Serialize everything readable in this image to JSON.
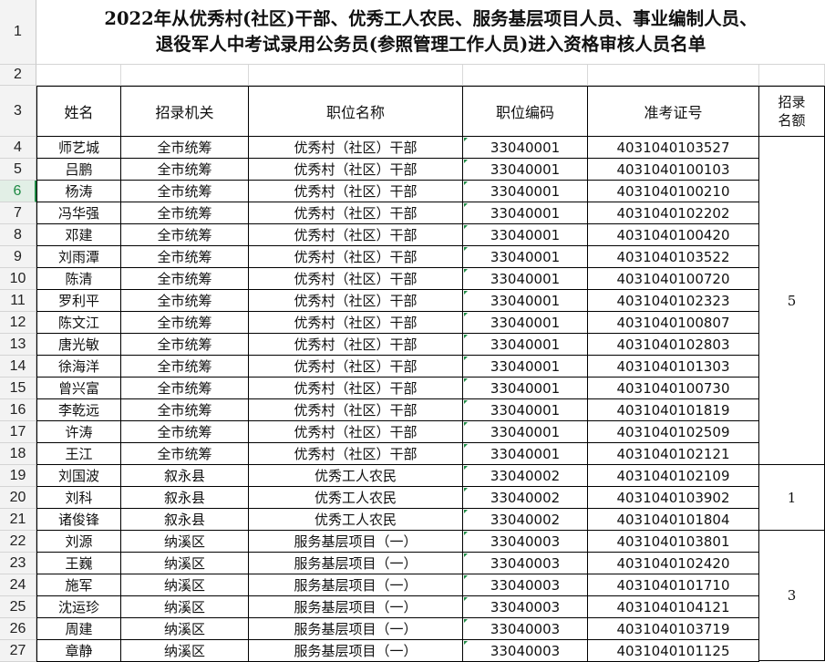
{
  "sheet": {
    "title_lines": [
      "2022年从优秀村(社区)干部、优秀工人农民、服务基层项目人员、事业编制人员、",
      "退役军人中考试录用公务员(参照管理工作人员)进入资格审核人员名单"
    ],
    "active_row": 6,
    "row_numbers": [
      "1",
      "2",
      "3",
      "4",
      "5",
      "6",
      "7",
      "8",
      "9",
      "10",
      "11",
      "12",
      "13",
      "14",
      "15",
      "16",
      "17",
      "18",
      "19",
      "20",
      "21",
      "22",
      "23",
      "24",
      "25",
      "26",
      "27"
    ],
    "headers": {
      "name": "姓名",
      "agency": "招录机关",
      "position": "职位名称",
      "code": "职位编码",
      "ticket": "准考证号",
      "quota": [
        "招录",
        "名额"
      ]
    },
    "rows": [
      {
        "name": "师艺城",
        "agency": "全市统筹",
        "position": "优秀村（社区）干部",
        "code": "33040001",
        "ticket": "4031040103527"
      },
      {
        "name": "吕鹏",
        "agency": "全市统筹",
        "position": "优秀村（社区）干部",
        "code": "33040001",
        "ticket": "4031040100103"
      },
      {
        "name": "杨涛",
        "agency": "全市统筹",
        "position": "优秀村（社区）干部",
        "code": "33040001",
        "ticket": "4031040100210"
      },
      {
        "name": "冯华强",
        "agency": "全市统筹",
        "position": "优秀村（社区）干部",
        "code": "33040001",
        "ticket": "4031040102202"
      },
      {
        "name": "邓建",
        "agency": "全市统筹",
        "position": "优秀村（社区）干部",
        "code": "33040001",
        "ticket": "4031040100420"
      },
      {
        "name": "刘雨潭",
        "agency": "全市统筹",
        "position": "优秀村（社区）干部",
        "code": "33040001",
        "ticket": "4031040103522"
      },
      {
        "name": "陈清",
        "agency": "全市统筹",
        "position": "优秀村（社区）干部",
        "code": "33040001",
        "ticket": "4031040100720"
      },
      {
        "name": "罗利平",
        "agency": "全市统筹",
        "position": "优秀村（社区）干部",
        "code": "33040001",
        "ticket": "4031040102323"
      },
      {
        "name": "陈文江",
        "agency": "全市统筹",
        "position": "优秀村（社区）干部",
        "code": "33040001",
        "ticket": "4031040100807"
      },
      {
        "name": "唐光敏",
        "agency": "全市统筹",
        "position": "优秀村（社区）干部",
        "code": "33040001",
        "ticket": "4031040102803"
      },
      {
        "name": "徐海洋",
        "agency": "全市统筹",
        "position": "优秀村（社区）干部",
        "code": "33040001",
        "ticket": "4031040101303"
      },
      {
        "name": "曾兴富",
        "agency": "全市统筹",
        "position": "优秀村（社区）干部",
        "code": "33040001",
        "ticket": "4031040100730"
      },
      {
        "name": "李乾远",
        "agency": "全市统筹",
        "position": "优秀村（社区）干部",
        "code": "33040001",
        "ticket": "4031040101819"
      },
      {
        "name": "许涛",
        "agency": "全市统筹",
        "position": "优秀村（社区）干部",
        "code": "33040001",
        "ticket": "4031040102509"
      },
      {
        "name": "王江",
        "agency": "全市统筹",
        "position": "优秀村（社区）干部",
        "code": "33040001",
        "ticket": "4031040102121"
      },
      {
        "name": "刘国波",
        "agency": "叙永县",
        "position": "优秀工人农民",
        "code": "33040002",
        "ticket": "4031040102109"
      },
      {
        "name": "刘科",
        "agency": "叙永县",
        "position": "优秀工人农民",
        "code": "33040002",
        "ticket": "4031040103902"
      },
      {
        "name": "诸俊锋",
        "agency": "叙永县",
        "position": "优秀工人农民",
        "code": "33040002",
        "ticket": "4031040101804"
      },
      {
        "name": "刘源",
        "agency": "纳溪区",
        "position": "服务基层项目（一）",
        "code": "33040003",
        "ticket": "4031040103801"
      },
      {
        "name": "王巍",
        "agency": "纳溪区",
        "position": "服务基层项目（一）",
        "code": "33040003",
        "ticket": "4031040102420"
      },
      {
        "name": "施军",
        "agency": "纳溪区",
        "position": "服务基层项目（一）",
        "code": "33040003",
        "ticket": "4031040101710"
      },
      {
        "name": "沈运珍",
        "agency": "纳溪区",
        "position": "服务基层项目（一）",
        "code": "33040003",
        "ticket": "4031040104121"
      },
      {
        "name": "周建",
        "agency": "纳溪区",
        "position": "服务基层项目（一）",
        "code": "33040003",
        "ticket": "4031040103719"
      },
      {
        "name": "章静",
        "agency": "纳溪区",
        "position": "服务基层项目（一）",
        "code": "33040003",
        "ticket": "4031040101125"
      }
    ],
    "quotas": [
      {
        "value": "5",
        "first_row": 0,
        "last_row": 14
      },
      {
        "value": "1",
        "first_row": 15,
        "last_row": 17
      },
      {
        "value": "3",
        "first_row": 18,
        "last_row": 23
      }
    ]
  }
}
